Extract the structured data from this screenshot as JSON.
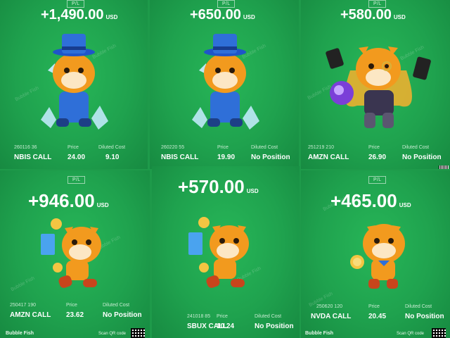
{
  "cards": [
    {
      "pl_label": "P/L",
      "amount": "+1,490.00",
      "currency": "USD",
      "code": "260116 36",
      "symbol": "NBIS CALL",
      "price_label": "Price",
      "price": "24.00",
      "cost_label": "Diluted Cost",
      "cost": "9.10",
      "mascot": "bull-tophat-crystals-icon"
    },
    {
      "pl_label": "P/L",
      "amount": "+650.00",
      "currency": "USD",
      "code": "260220 55",
      "symbol": "NBIS CALL",
      "price_label": "Price",
      "price": "19.90",
      "cost_label": "Diluted Cost",
      "cost": "No Position",
      "mascot": "bull-tophat-crystals-icon"
    },
    {
      "pl_label": "P/L",
      "amount": "+580.00",
      "currency": "USD",
      "code": "251219 210",
      "symbol": "AMZN CALL",
      "price_label": "Price",
      "price": "26.90",
      "cost_label": "Diluted Cost",
      "cost": "No Position",
      "mascot": "bull-monocle-orb-icon"
    },
    {
      "pl_label": "P/L",
      "amount": "+946.00",
      "currency": "USD",
      "code": "250417 190",
      "symbol": "AMZN CALL",
      "price_label": "Price",
      "price": "23.62",
      "cost_label": "Diluted Cost",
      "cost": "No Position",
      "mascot": "bull-walking-coins-icon"
    },
    {
      "pl_label": "",
      "amount": "+570.00",
      "currency": "USD",
      "code": "241018 85",
      "symbol": "SBUX CALL",
      "price_label": "Price",
      "price": "10.24",
      "cost_label": "Diluted Cost",
      "cost": "No Position",
      "mascot": "bull-walking-coins-icon"
    },
    {
      "pl_label": "P/L",
      "amount": "+465.00",
      "currency": "USD",
      "code": "250620 120",
      "symbol": "NVDA CALL",
      "price_label": "Price",
      "price": "20.45",
      "cost_label": "Diluted Cost",
      "cost": "No Position",
      "mascot": "bull-holding-coin-icon"
    }
  ],
  "watermark": "Bubble Fish",
  "footer": {
    "brand": "Bubble Fish",
    "scan": "Scan QR code"
  },
  "colors": {
    "background": "#1fa24e",
    "mascot_orange": "#f29a1e",
    "suit_blue": "#2f6fd8",
    "coin_gold": "#f4c542"
  }
}
